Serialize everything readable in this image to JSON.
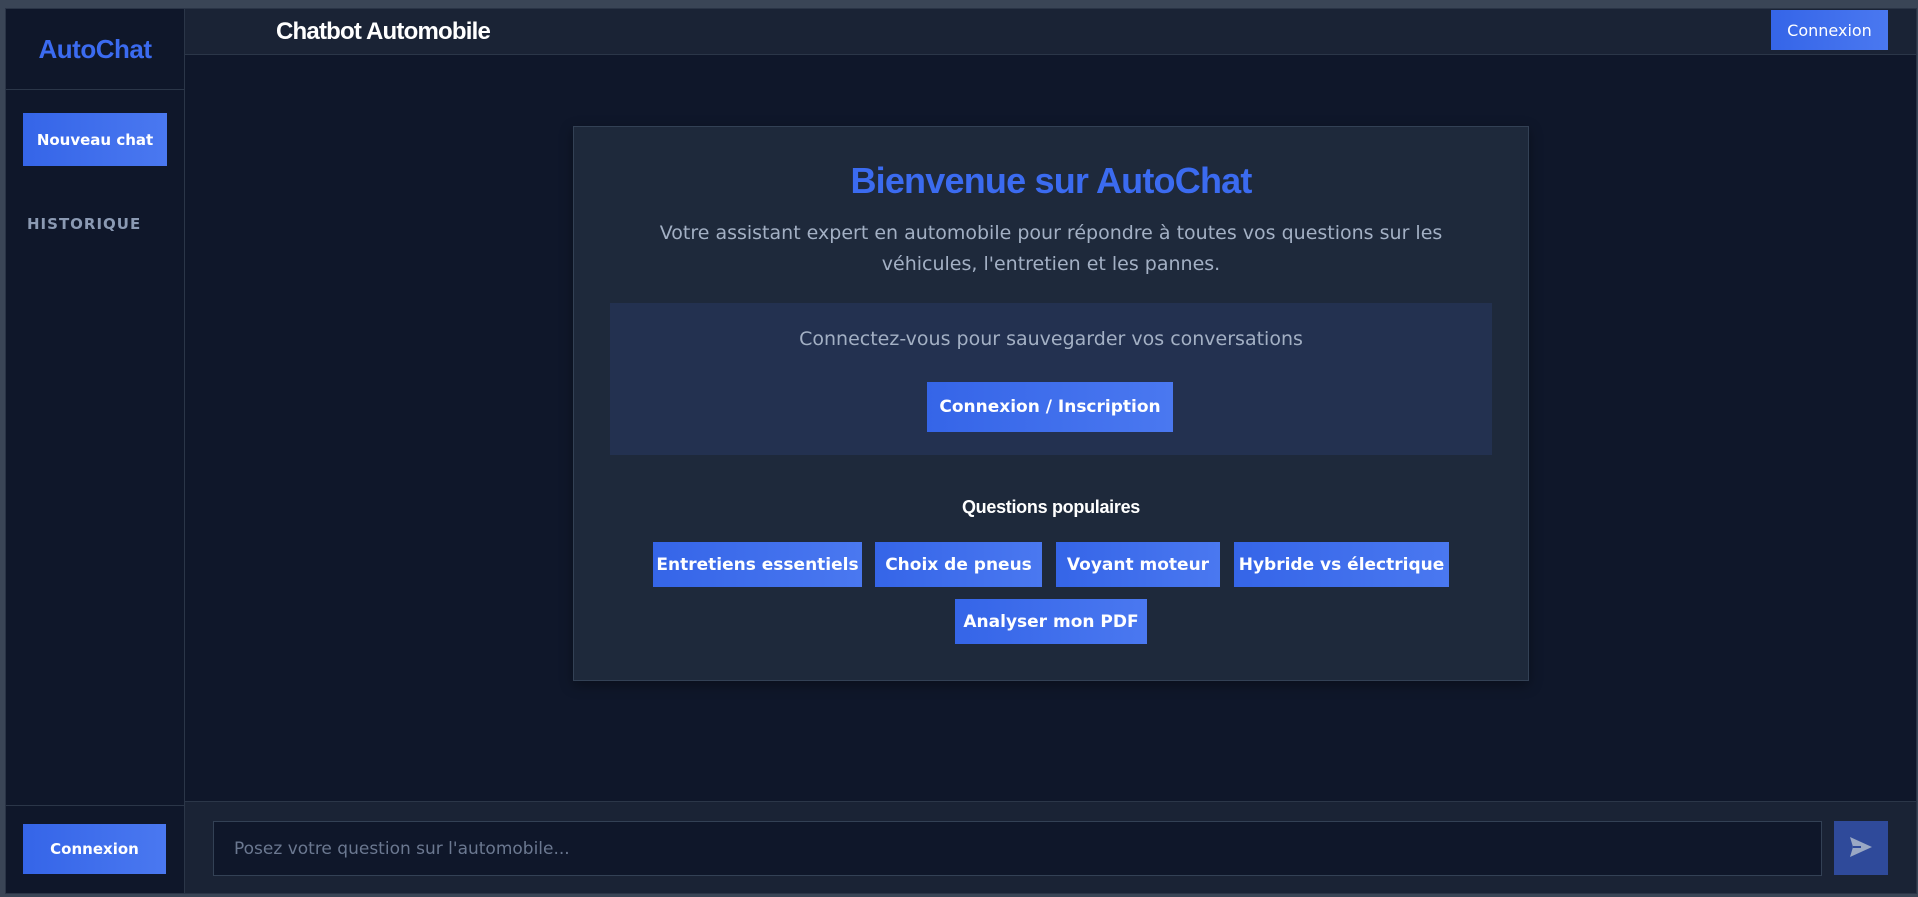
{
  "sidebar": {
    "brand": "AutoChat",
    "new_chat_label": "Nouveau chat",
    "history_label": "HISTORIQUE",
    "login_label": "Connexion"
  },
  "header": {
    "title": "Chatbot Automobile",
    "login_label": "Connexion"
  },
  "welcome": {
    "title": "Bienvenue sur AutoChat",
    "subtitle": "Votre assistant expert en automobile pour répondre à toutes vos questions sur les véhicules, l'entretien et les pannes.",
    "login_prompt": "Connectez-vous pour sauvegarder vos conversations",
    "login_button": "Connexion / Inscription",
    "popular_title": "Questions populaires",
    "popular_questions": [
      "Entretiens essentiels",
      "Choix de pneus",
      "Voyant moteur",
      "Hybride vs électrique",
      "Analyser mon PDF"
    ]
  },
  "input": {
    "placeholder": "Posez votre question sur l'automobile...",
    "send_icon": "send-icon"
  },
  "colors": {
    "accent": "#3b6bf0",
    "background": "#0f172a",
    "panel": "#1e293b"
  }
}
